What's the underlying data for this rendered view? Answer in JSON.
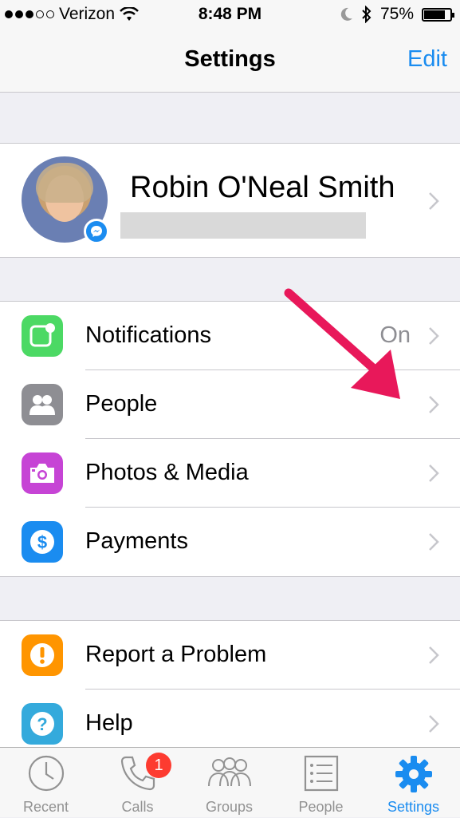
{
  "status_bar": {
    "carrier": "Verizon",
    "signal_bars": 3,
    "time": "8:48 PM",
    "battery_text": "75%",
    "battery_level": 0.75
  },
  "nav": {
    "title": "Settings",
    "edit_label": "Edit"
  },
  "profile": {
    "name": "Robin O'Neal Smith"
  },
  "section1": [
    {
      "label": "Notifications",
      "value": "On",
      "icon": "notifications-icon",
      "color": "#4cd964"
    },
    {
      "label": "People",
      "icon": "people-icon",
      "color": "#8e8e93"
    },
    {
      "label": "Photos & Media",
      "icon": "camera-icon",
      "color": "#c644d5"
    },
    {
      "label": "Payments",
      "icon": "dollar-icon",
      "color": "#1a8cf0"
    }
  ],
  "section2": [
    {
      "label": "Report a Problem",
      "icon": "exclamation-icon",
      "color": "#ff9500"
    },
    {
      "label": "Help",
      "icon": "question-icon",
      "color": "#34aadc"
    }
  ],
  "annotation": {
    "arrow_color": "#e8185a"
  },
  "tabs": [
    {
      "label": "Recent",
      "icon": "clock-icon"
    },
    {
      "label": "Calls",
      "icon": "phone-icon",
      "badge": "1"
    },
    {
      "label": "Groups",
      "icon": "groups-icon"
    },
    {
      "label": "People",
      "icon": "people-list-icon"
    },
    {
      "label": "Settings",
      "icon": "gear-icon",
      "active": true
    }
  ],
  "accent_color": "#1a8cf0"
}
